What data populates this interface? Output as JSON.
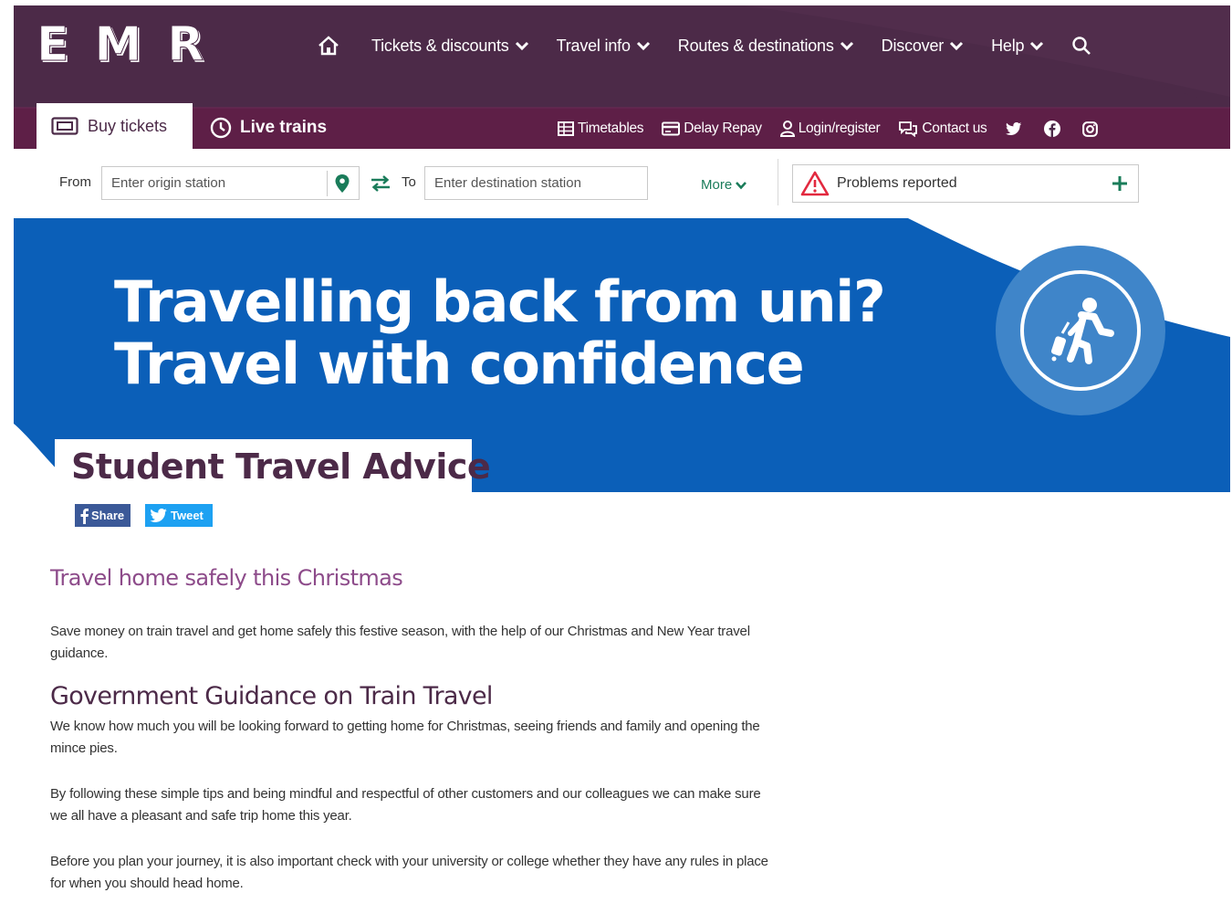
{
  "colors": {
    "brand_purple": "#4c2a48",
    "hero_blue": "#0b5fb8",
    "accent_green": "#1a7c5a",
    "subheading_purple": "#8d4b8a",
    "facebook": "#3b5998",
    "twitter": "#1da1f2"
  },
  "logo": {
    "letters": [
      "E",
      "M",
      "R"
    ]
  },
  "nav": {
    "home_icon": "home-icon",
    "items": [
      {
        "label": "Tickets & discounts"
      },
      {
        "label": "Travel info"
      },
      {
        "label": "Routes & destinations"
      },
      {
        "label": "Discover"
      },
      {
        "label": "Help"
      }
    ],
    "search_icon": "search-icon"
  },
  "tabs": {
    "buy": {
      "label": "Buy tickets",
      "icon": "ticket-icon"
    },
    "live": {
      "label": "Live trains",
      "icon": "clock-icon"
    }
  },
  "utility": {
    "timetables": "Timetables",
    "delay_repay": "Delay Repay",
    "login": "Login/register",
    "contact": "Contact us",
    "social": [
      "twitter-icon",
      "facebook-icon",
      "instagram-icon"
    ]
  },
  "journey": {
    "from_label": "From",
    "from_placeholder": "Enter origin station",
    "to_label": "To",
    "to_placeholder": "Enter destination station",
    "more_label": "More"
  },
  "alerts": {
    "label": "Problems reported"
  },
  "hero": {
    "line1": "Travelling back from uni?",
    "line2": "Travel with confidence",
    "icon": "traveller-with-luggage-icon"
  },
  "page": {
    "title": "Student Travel Advice"
  },
  "share": {
    "facebook": "Share",
    "twitter": "Tweet"
  },
  "content": {
    "subheading": "Travel home safely this Christmas",
    "intro": "Save money on train travel and get home safely this festive season, with the help of our Christmas and New Year travel guidance.",
    "heading": "Government Guidance on Train Travel",
    "paragraphs": [
      "We know how much you will be looking forward to getting home for Christmas, seeing friends and family and opening the mince pies.",
      "By following these simple tips and being mindful and respectful of other customers and our colleagues we can make sure we all have a pleasant and safe trip home this year.",
      "Before you plan your journey, it is also important check with your university or college whether they have any rules in place for when you should head home."
    ]
  }
}
